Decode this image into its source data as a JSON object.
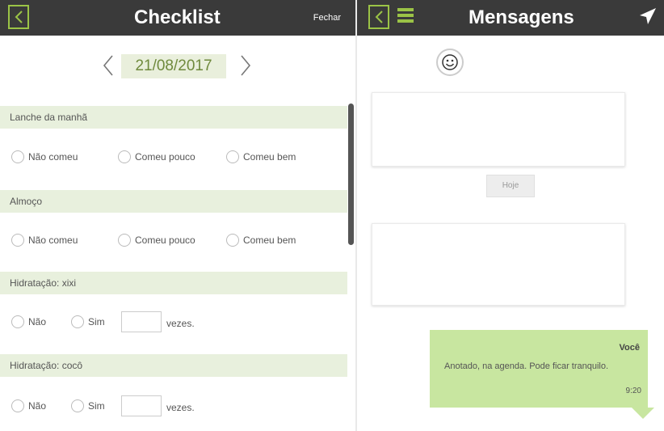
{
  "checklist": {
    "title": "Checklist",
    "close_label": "Fechar",
    "date": "21/08/2017",
    "sections": [
      {
        "heading": "Lanche da manhã",
        "options": [
          "Não comeu",
          "Comeu pouco",
          "Comeu bem"
        ]
      },
      {
        "heading": "Almoço",
        "options": [
          "Não comeu",
          "Comeu pouco",
          "Comeu bem"
        ]
      },
      {
        "heading": "Hidratação: xixi",
        "options": [
          "Não",
          "Sim"
        ],
        "suffix": "vezes."
      },
      {
        "heading": "Hidratação: cocô",
        "options": [
          "Não",
          "Sim"
        ],
        "suffix": "vezes."
      }
    ]
  },
  "messages": {
    "title": "Mensagens",
    "day_label": "Hoje",
    "bubble": {
      "sender": "Você",
      "text": "Anotado, na agenda. Pode ficar tranquilo.",
      "time": "9:20"
    }
  },
  "colors": {
    "accent": "#9bc346",
    "header": "#3a3a3a",
    "section_bg": "#e8f0dd",
    "bubble_bg": "#c8e6a0"
  },
  "icons": [
    "back-icon",
    "chevron-left-icon",
    "chevron-right-icon",
    "menu-icon",
    "send-icon",
    "emoji-icon"
  ]
}
